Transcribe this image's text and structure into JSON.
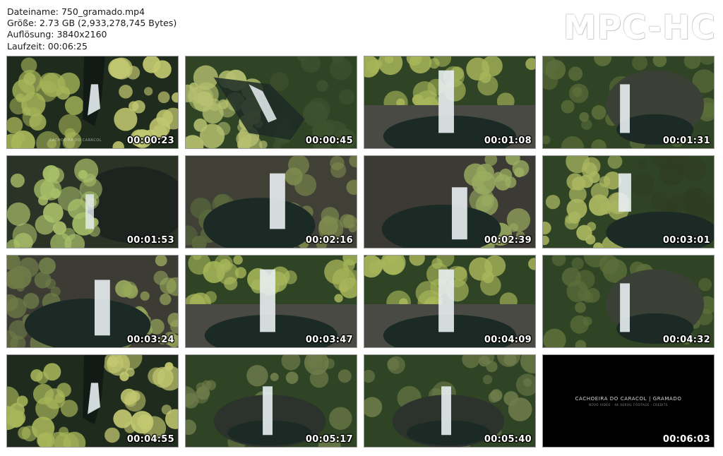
{
  "file_info": {
    "filename": "Dateiname: 750_gramado.mp4",
    "size": "Größe: 2.73 GB (2,933,278,745 Bytes)",
    "resolution": "Auflösung: 3840x2160",
    "duration": "Laufzeit: 00:06:25"
  },
  "brand": "MPC-HC",
  "thumbnails": [
    {
      "time": "00:00:23",
      "scene": "top-down-fall",
      "watermark": "CACHOEIRA DO CARACOL"
    },
    {
      "time": "00:00:45",
      "scene": "diagonal-fall",
      "watermark": ""
    },
    {
      "time": "00:01:08",
      "scene": "center-fall",
      "watermark": ""
    },
    {
      "time": "00:01:31",
      "scene": "right-fall",
      "watermark": ""
    },
    {
      "time": "00:01:53",
      "scene": "tree-left",
      "watermark": ""
    },
    {
      "time": "00:02:16",
      "scene": "canyon-fall",
      "watermark": ""
    },
    {
      "time": "00:02:39",
      "scene": "canyon-fall-right",
      "watermark": ""
    },
    {
      "time": "00:03:01",
      "scene": "top-canopy",
      "watermark": ""
    },
    {
      "time": "00:03:24",
      "scene": "left-fall",
      "watermark": ""
    },
    {
      "time": "00:03:47",
      "scene": "center-fall",
      "watermark": ""
    },
    {
      "time": "00:04:09",
      "scene": "center-fall",
      "watermark": ""
    },
    {
      "time": "00:04:32",
      "scene": "right-fall",
      "watermark": ""
    },
    {
      "time": "00:04:55",
      "scene": "top-down-fall",
      "watermark": ""
    },
    {
      "time": "00:05:17",
      "scene": "wide-canyon",
      "watermark": ""
    },
    {
      "time": "00:05:40",
      "scene": "wide-canyon",
      "watermark": ""
    },
    {
      "time": "00:06:03",
      "scene": "black-title",
      "watermark": ""
    }
  ],
  "end_title": {
    "main": "CACHOEIRA DO CARACOL | GRAMADO",
    "sub": "NOVO VIDEO · 4K AERIAL FOOTAGE · CREDITS"
  },
  "colors": {
    "foliage_light": "#a8b65a",
    "foliage_dark": "#2f4424",
    "rock": "#4a4a44",
    "water": "#e8eef2",
    "pool": "#1c2a26"
  }
}
